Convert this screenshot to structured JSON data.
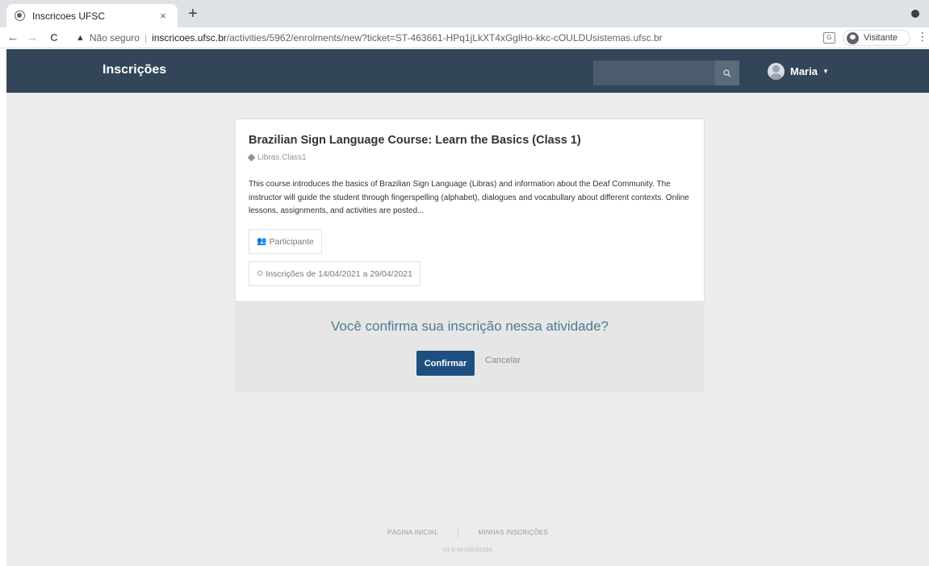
{
  "browser": {
    "tab_title": "Inscricoes UFSC",
    "tab_close": "×",
    "new_tab": "+",
    "back": "←",
    "forward": "→",
    "reload": "C",
    "security_warning_icon": "▲",
    "security_label": "Não seguro",
    "separator": "|",
    "url_host": "inscricoes.ufsc.br",
    "url_path": "/activities/5962/enrolments/new?ticket=ST-463661-HPq1jLkXT4xGglHo-kkc-cOULDUsistemas.ufsc.br",
    "profile_label": "Visitante",
    "menu": "⋮"
  },
  "header": {
    "brand": "Inscrições",
    "search_placeholder": "",
    "search_icon": "search-icon",
    "user_name": "Maria",
    "user_caret": "▼"
  },
  "activity": {
    "title": "Brazilian Sign Language Course: Learn the Basics (Class 1)",
    "tag": "Libras.Class1",
    "description": "This course introduces the basics of Brazilian Sign Language (Libras) and information about the Deaf Community. The instructor will guide the student through fingerspelling (alphabet), dialogues and vocabullary about different contexts. Online lessons, assignments, and activities are posted...",
    "role_label": "Participante",
    "role_icon": "👥",
    "period_label": "Inscrições de 14/04/2021 a 29/04/2021",
    "period_icon": "⊙"
  },
  "confirmation": {
    "question": "Você confirma sua inscrição nessa atividade?",
    "confirm_label": "Confirmar",
    "cancel_label": "Cancelar"
  },
  "footer": {
    "home_link": "PÁGINA INICIAL",
    "my_enrolments_link": "MINHAS INSCRIÇÕES",
    "version": "V1.5-49-G9D6159A"
  },
  "colors": {
    "header_bg": "#334558",
    "page_bg": "#ececec",
    "confirm_button": "#1f4f80",
    "question_text": "#4f7a93"
  }
}
